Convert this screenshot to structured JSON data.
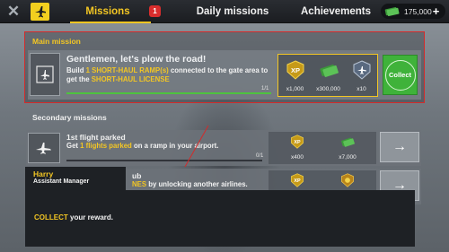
{
  "topbar": {
    "tabs": [
      {
        "label": "Missions",
        "active": true
      },
      {
        "label": "Daily missions",
        "active": false
      },
      {
        "label": "Achievements",
        "active": false
      }
    ],
    "missions_badge": "1",
    "cash": "175,000"
  },
  "main_mission": {
    "section_title": "Main mission",
    "heading": "Gentlemen, let's plow the road!",
    "desc_part1": "Build ",
    "desc_hl1": "1 SHORT-HAUL RAMP(s)",
    "desc_part2": " connected to the gate area to get the ",
    "desc_hl2": "SHORT-HAUL LICENSE",
    "progress_label": "1/1",
    "progress": 1.0,
    "rewards": [
      {
        "icon": "xp-icon",
        "value": "x1,000"
      },
      {
        "icon": "cash-stack-icon",
        "value": "x300,000"
      },
      {
        "icon": "airplane-token-icon",
        "value": "x10"
      }
    ],
    "collect_label": "Collect"
  },
  "secondary": {
    "section_title": "Secondary missions",
    "missions": [
      {
        "heading": "1st flight parked",
        "desc_part1": "Get ",
        "desc_hl": "1 flights parked",
        "desc_part2": " on a ramp in your airport.",
        "progress_label": "0/1",
        "progress": 0.0,
        "rewards": [
          {
            "icon": "xp-icon",
            "value": "x400"
          },
          {
            "icon": "cash-stack-icon",
            "value": "x7,000"
          }
        ]
      },
      {
        "heading": "ub",
        "desc_part1": "",
        "desc_hl": "NES",
        "desc_part2": " by unlocking another airlines.",
        "rewards": [
          {
            "icon": "xp-icon",
            "value": ""
          },
          {
            "icon": "gold-badge-icon",
            "value": ""
          }
        ]
      }
    ]
  },
  "tutorial": {
    "speaker_name": "Harry",
    "speaker_role": "Assistant Manager",
    "message_hl": "COLLECT",
    "message_rest": " your reward."
  },
  "colors": {
    "accent_yellow": "#f3c623",
    "collect_green": "#3fb23a",
    "highlight_red": "#d32b2b",
    "progress_green": "#4ec23f"
  }
}
